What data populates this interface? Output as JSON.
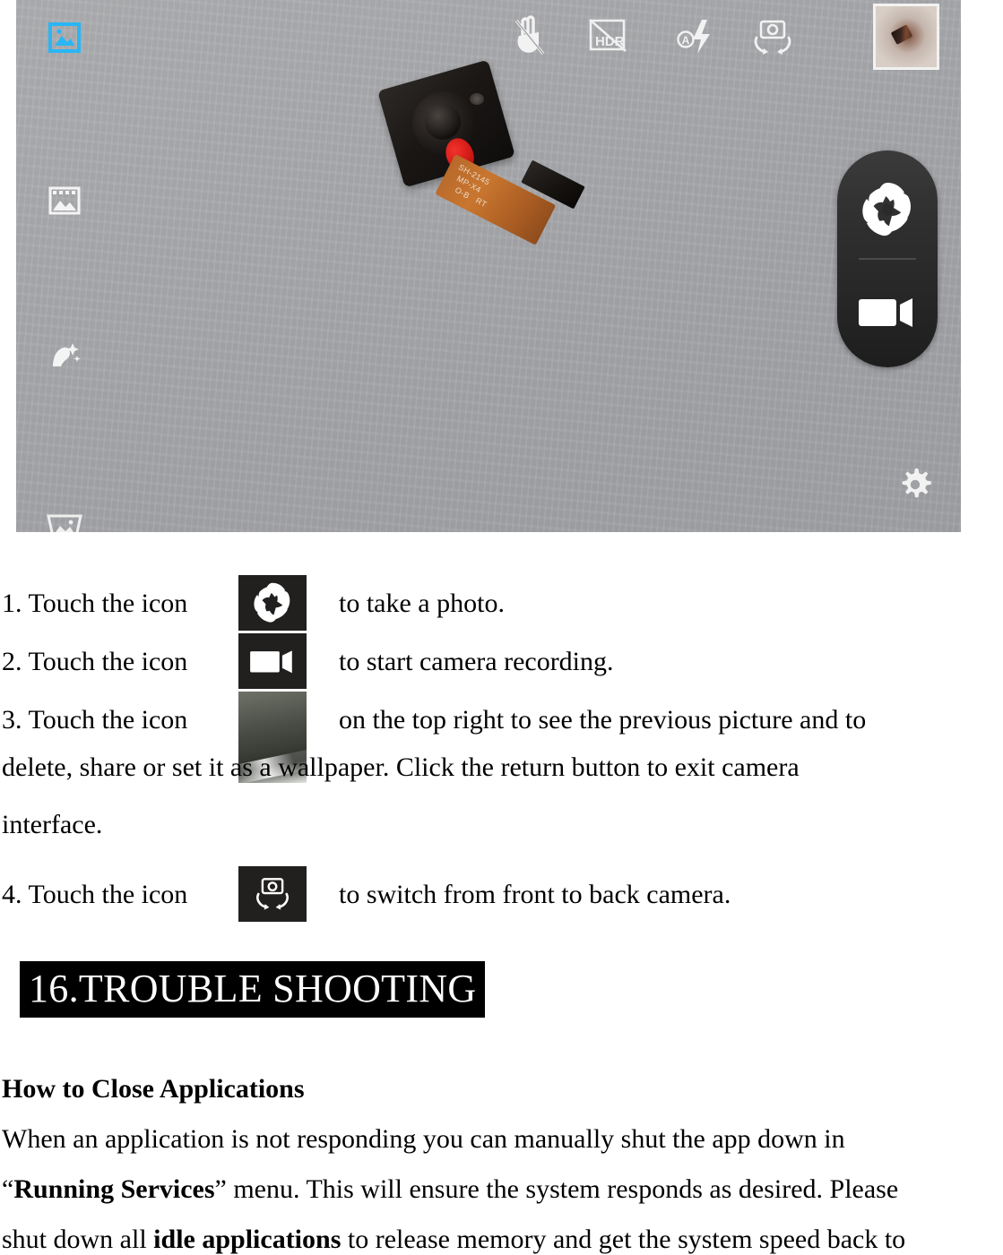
{
  "screenshot": {
    "name": "android-camera-preview",
    "background_color": "#a7a8ab",
    "mode_rail": [
      {
        "name": "photo-mode-icon",
        "label": "Photo mode",
        "color": "#29b6f6",
        "active": true
      },
      {
        "name": "panorama-mode-icon",
        "label": "Panorama mode",
        "color": "#ffffff",
        "active": false
      },
      {
        "name": "beauty-mode-icon",
        "label": "Beauty face mode",
        "color": "#ffffff",
        "active": false
      },
      {
        "name": "wide-panorama-mode-icon",
        "label": "Wide panorama mode",
        "color": "#ffffff",
        "active": false
      }
    ],
    "top_toolbar": [
      {
        "name": "gesture-shot-icon",
        "label": "Gesture shot off",
        "state": "off"
      },
      {
        "name": "hdr-icon",
        "label": "HDR off",
        "state": "off"
      },
      {
        "name": "flash-auto-icon",
        "label": "Flash auto",
        "state": "auto",
        "badge": "A"
      },
      {
        "name": "switch-camera-icon",
        "label": "Switch camera",
        "state": "on"
      }
    ],
    "thumbnail": {
      "name": "last-photo-thumbnail",
      "label": "Last captured photo"
    },
    "shutter_pill": {
      "photo_button": {
        "name": "shutter-button",
        "label": "Take photo"
      },
      "video_button": {
        "name": "record-button",
        "label": "Start recording"
      }
    },
    "settings": {
      "name": "settings-gear-icon",
      "label": "Camera settings"
    },
    "subject": {
      "name": "camera-module-photo",
      "label": "Camera module on grey surface",
      "flex_text_lines": [
        "SH-2145",
        "MP-X4",
        "O-B",
        "RT"
      ]
    }
  },
  "steps": [
    {
      "lead": "1. Touch the icon",
      "icon": "shutter-icon",
      "icon_label": "Shutter / aperture icon",
      "tail": "to take a photo."
    },
    {
      "lead": "2. Touch the icon",
      "icon": "video-camera-icon",
      "icon_label": "Video camera icon",
      "tail": "to start camera recording."
    },
    {
      "lead": "3. Touch the icon",
      "icon": "photo-thumbnail-icon",
      "icon_label": "Previous picture thumbnail",
      "tail": "on the top right to see the previous picture and to"
    },
    {
      "lead": "4. Touch the icon",
      "icon": "switch-camera-icon",
      "icon_label": "Switch camera icon",
      "tail": "to switch from front to back camera."
    }
  ],
  "wrap_lines": [
    "delete, share or set it as a wallpaper. Click the return button to exit camera",
    "interface."
  ],
  "section": {
    "heading": "16.TROUBLE SHOOTING",
    "heading_bg": "#000000",
    "heading_fg": "#ffffff",
    "subheading": "How to Close Applications",
    "paragraph_lines": [
      {
        "parts": [
          {
            "text": "When an application is not responding you can manually shut the app down in",
            "bold": false
          }
        ]
      },
      {
        "parts": [
          {
            "text": "“",
            "bold": false
          },
          {
            "text": "Running Services",
            "bold": true
          },
          {
            "text": "” menu. This will ensure the system responds as desired. Please",
            "bold": false
          }
        ]
      },
      {
        "parts": [
          {
            "text": "shut down all ",
            "bold": false
          },
          {
            "text": "idle applications",
            "bold": true
          },
          {
            "text": " to release memory and get the system speed back to",
            "bold": false
          }
        ]
      }
    ]
  }
}
